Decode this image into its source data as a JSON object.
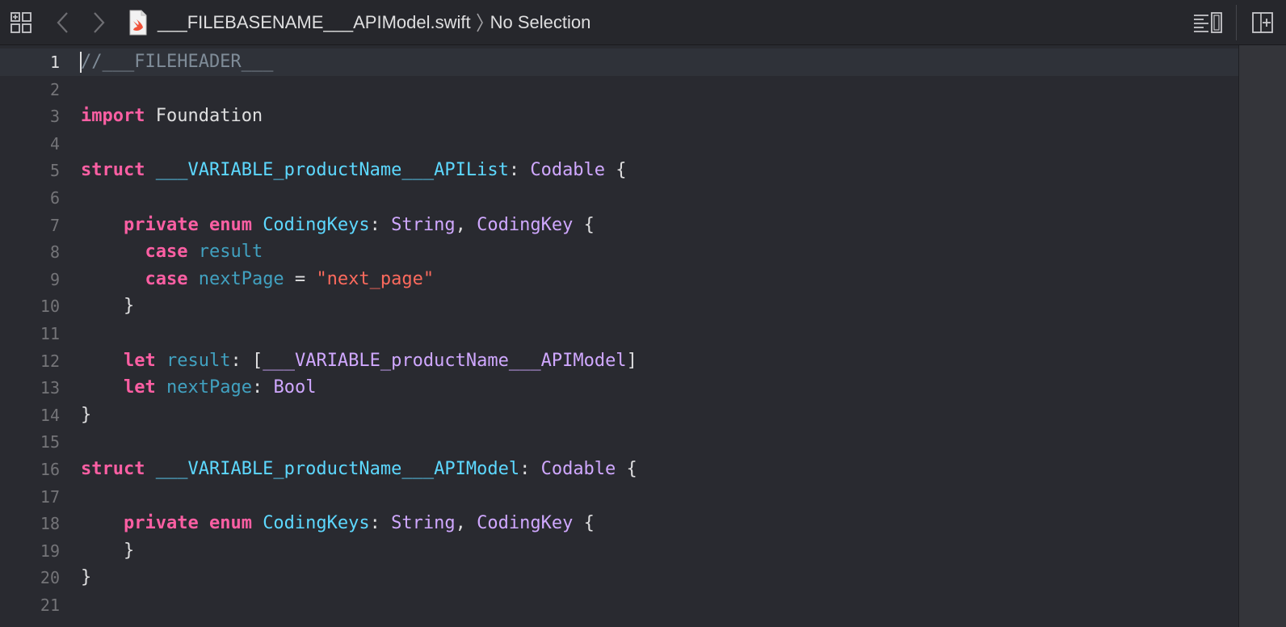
{
  "topbar": {
    "filename": "___FILEBASENAME___APIModel.swift",
    "selection": "No Selection"
  },
  "icons": {
    "related_items": "grid-icon",
    "back": "chevron-left-icon",
    "forward": "chevron-right-icon",
    "file": "swift-file-icon",
    "adjust_editor": "minimap-icon",
    "add_editor": "add-editor-icon"
  },
  "editor": {
    "current_line": 1,
    "lines": [
      {
        "n": "1",
        "tokens": [
          {
            "t": "//___FILEHEADER___",
            "k": "cmt"
          }
        ]
      },
      {
        "n": "2",
        "tokens": []
      },
      {
        "n": "3",
        "tokens": [
          {
            "t": "import",
            "k": "kw"
          },
          {
            "t": " Foundation",
            "k": "pl"
          }
        ]
      },
      {
        "n": "4",
        "tokens": []
      },
      {
        "n": "5",
        "tokens": [
          {
            "t": "struct",
            "k": "kw"
          },
          {
            "t": " ",
            "k": "pl"
          },
          {
            "t": "___VARIABLE_productName___APIList",
            "k": "type"
          },
          {
            "t": ": ",
            "k": "pl"
          },
          {
            "t": "Codable",
            "k": "std"
          },
          {
            "t": " {",
            "k": "pl"
          }
        ]
      },
      {
        "n": "6",
        "tokens": []
      },
      {
        "n": "7",
        "tokens": [
          {
            "t": "    ",
            "k": "pl"
          },
          {
            "t": "private",
            "k": "kw"
          },
          {
            "t": " ",
            "k": "pl"
          },
          {
            "t": "enum",
            "k": "kw"
          },
          {
            "t": " ",
            "k": "pl"
          },
          {
            "t": "CodingKeys",
            "k": "type"
          },
          {
            "t": ": ",
            "k": "pl"
          },
          {
            "t": "String",
            "k": "std"
          },
          {
            "t": ", ",
            "k": "pl"
          },
          {
            "t": "CodingKey",
            "k": "std"
          },
          {
            "t": " {",
            "k": "pl"
          }
        ]
      },
      {
        "n": "8",
        "tokens": [
          {
            "t": "      ",
            "k": "pl"
          },
          {
            "t": "case",
            "k": "kw"
          },
          {
            "t": " ",
            "k": "pl"
          },
          {
            "t": "result",
            "k": "prop"
          }
        ]
      },
      {
        "n": "9",
        "tokens": [
          {
            "t": "      ",
            "k": "pl"
          },
          {
            "t": "case",
            "k": "kw"
          },
          {
            "t": " ",
            "k": "pl"
          },
          {
            "t": "nextPage",
            "k": "prop"
          },
          {
            "t": " = ",
            "k": "pl"
          },
          {
            "t": "\"next_page\"",
            "k": "str"
          }
        ]
      },
      {
        "n": "10",
        "tokens": [
          {
            "t": "    }",
            "k": "pl"
          }
        ]
      },
      {
        "n": "11",
        "tokens": []
      },
      {
        "n": "12",
        "tokens": [
          {
            "t": "    ",
            "k": "pl"
          },
          {
            "t": "let",
            "k": "kw"
          },
          {
            "t": " ",
            "k": "pl"
          },
          {
            "t": "result",
            "k": "prop"
          },
          {
            "t": ": [",
            "k": "pl"
          },
          {
            "t": "___VARIABLE_productName___APIModel",
            "k": "std"
          },
          {
            "t": "]",
            "k": "pl"
          }
        ]
      },
      {
        "n": "13",
        "tokens": [
          {
            "t": "    ",
            "k": "pl"
          },
          {
            "t": "let",
            "k": "kw"
          },
          {
            "t": " ",
            "k": "pl"
          },
          {
            "t": "nextPage",
            "k": "prop"
          },
          {
            "t": ": ",
            "k": "pl"
          },
          {
            "t": "Bool",
            "k": "std"
          }
        ]
      },
      {
        "n": "14",
        "tokens": [
          {
            "t": "}",
            "k": "pl"
          }
        ]
      },
      {
        "n": "15",
        "tokens": []
      },
      {
        "n": "16",
        "tokens": [
          {
            "t": "struct",
            "k": "kw"
          },
          {
            "t": " ",
            "k": "pl"
          },
          {
            "t": "___VARIABLE_productName___APIModel",
            "k": "type"
          },
          {
            "t": ": ",
            "k": "pl"
          },
          {
            "t": "Codable",
            "k": "std"
          },
          {
            "t": " {",
            "k": "pl"
          }
        ]
      },
      {
        "n": "17",
        "tokens": []
      },
      {
        "n": "18",
        "tokens": [
          {
            "t": "    ",
            "k": "pl"
          },
          {
            "t": "private",
            "k": "kw"
          },
          {
            "t": " ",
            "k": "pl"
          },
          {
            "t": "enum",
            "k": "kw"
          },
          {
            "t": " ",
            "k": "pl"
          },
          {
            "t": "CodingKeys",
            "k": "type"
          },
          {
            "t": ": ",
            "k": "pl"
          },
          {
            "t": "String",
            "k": "std"
          },
          {
            "t": ", ",
            "k": "pl"
          },
          {
            "t": "CodingKey",
            "k": "std"
          },
          {
            "t": " {",
            "k": "pl"
          }
        ]
      },
      {
        "n": "19",
        "tokens": [
          {
            "t": "    }",
            "k": "pl"
          }
        ]
      },
      {
        "n": "20",
        "tokens": [
          {
            "t": "}",
            "k": "pl"
          }
        ]
      },
      {
        "n": "21",
        "tokens": []
      }
    ]
  },
  "colors": {
    "background": "#292a30",
    "keyword": "#fc5fa3",
    "type_declaration": "#5dd8ff",
    "other_type": "#d0a8ff",
    "property": "#41a1c0",
    "string": "#fc6a5d",
    "comment": "#7f8c98",
    "plain": "#dfdfe0"
  }
}
